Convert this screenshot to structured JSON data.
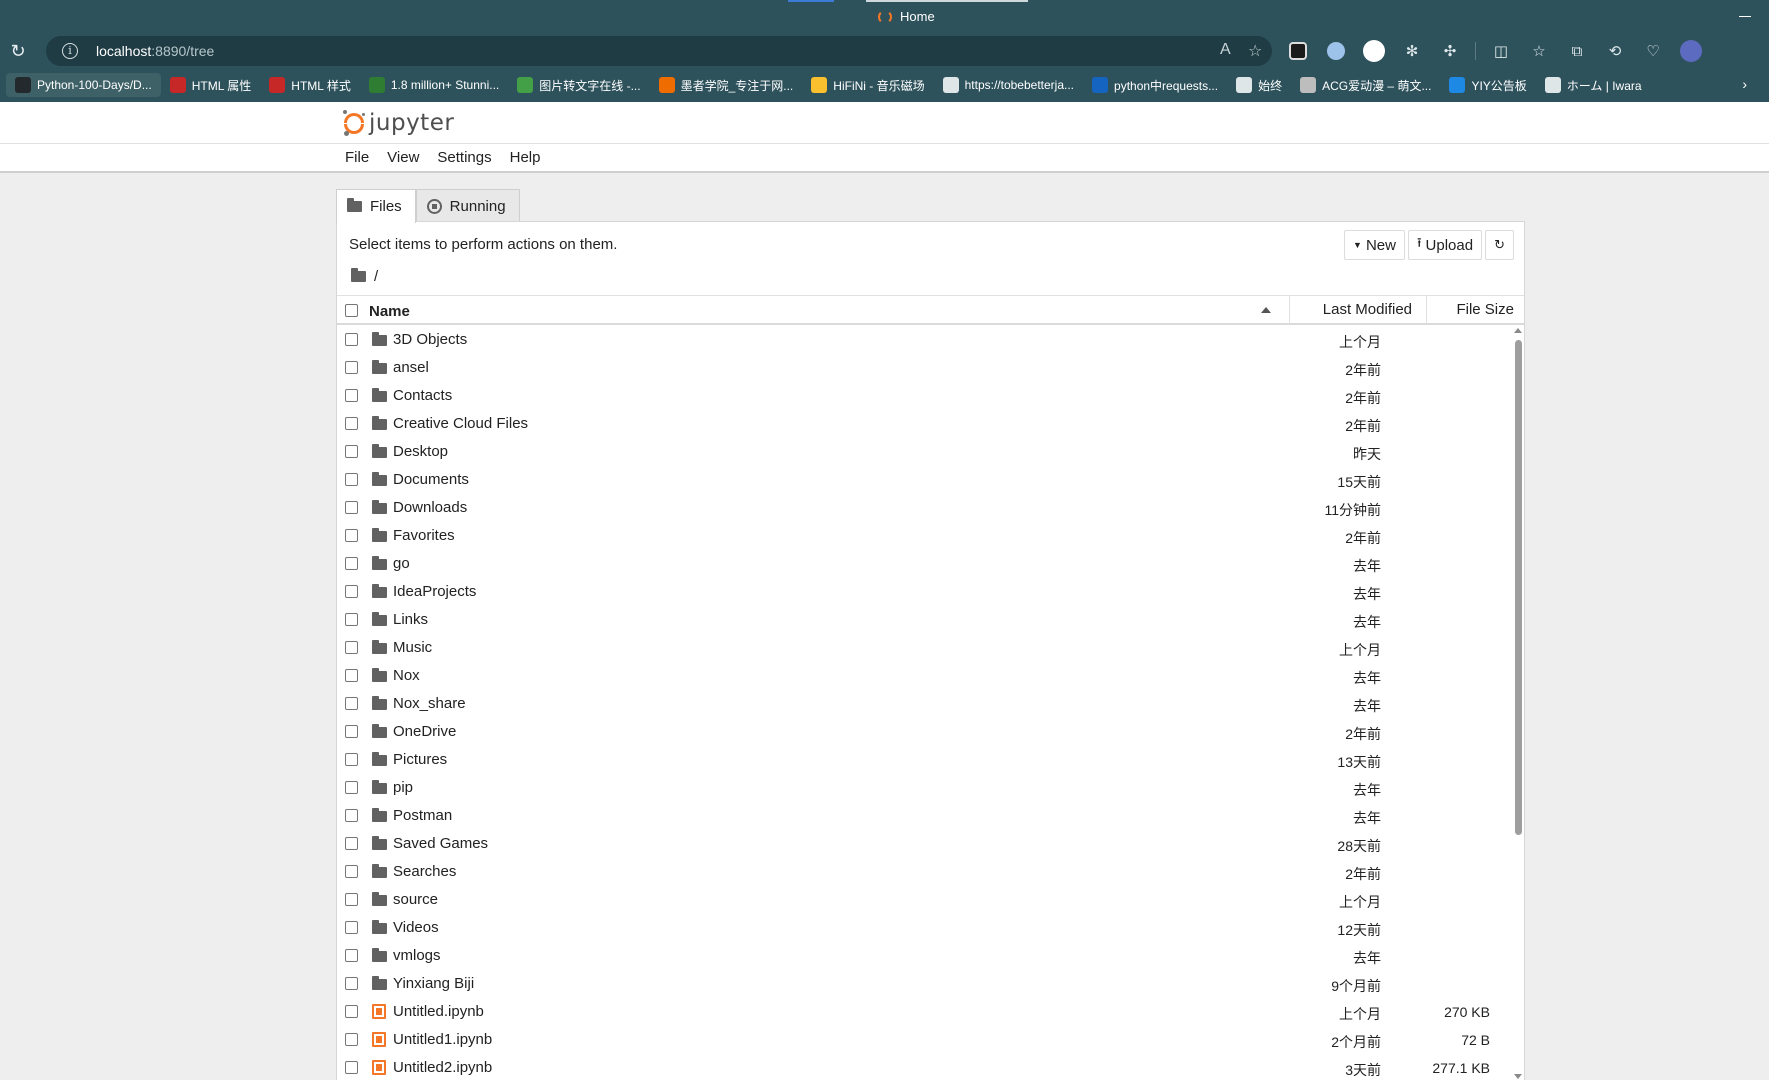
{
  "browser": {
    "tab_title": "Home",
    "url_host": "localhost",
    "url_rest": ":8890/tree",
    "bookmarks": [
      {
        "label": "Python-100-Days/D...",
        "icon": "github-icon",
        "color": "#24292e"
      },
      {
        "label": "HTML 属性",
        "icon": "html-icon",
        "color": "#c62828"
      },
      {
        "label": "HTML 样式",
        "icon": "html-icon",
        "color": "#c62828"
      },
      {
        "label": "1.8 million+ Stunni...",
        "icon": "px-icon",
        "color": "#2e7d32"
      },
      {
        "label": "图片转文字在线 -...",
        "icon": "leaf-icon",
        "color": "#43a047"
      },
      {
        "label": "墨者学院_专注于网...",
        "icon": "mozhe-icon",
        "color": "#ef6c00"
      },
      {
        "label": "HiFiNi - 音乐磁场",
        "icon": "music-icon",
        "color": "#fbc02d"
      },
      {
        "label": "https://tobebetterja...",
        "icon": "doc-icon",
        "color": "#eeeeee"
      },
      {
        "label": "python中requests...",
        "icon": "zhihu-icon",
        "color": "#1565c0"
      },
      {
        "label": "始终",
        "icon": "clock-icon",
        "color": "#ffffff"
      },
      {
        "label": "ACG爱动漫 – 萌文...",
        "icon": "acg-icon",
        "color": "#bdbdbd"
      },
      {
        "label": "YIY公告板",
        "icon": "s-icon",
        "color": "#1e88e5"
      },
      {
        "label": "ホーム | Iwara",
        "icon": "diamond-icon",
        "color": "#ffffff"
      }
    ]
  },
  "jupyter": {
    "logo_text": "jupyter",
    "menu": [
      "File",
      "View",
      "Settings",
      "Help"
    ],
    "tabs": {
      "files": "Files",
      "running": "Running"
    },
    "hint": "Select items to perform actions on them.",
    "buttons": {
      "new": "New",
      "upload": "Upload"
    },
    "breadcrumb": "/",
    "columns": {
      "name": "Name",
      "modified": "Last Modified",
      "size": "File Size"
    },
    "rows": [
      {
        "name": "3D Objects",
        "modified": "上个月",
        "size": "",
        "type": "folder"
      },
      {
        "name": "ansel",
        "modified": "2年前",
        "size": "",
        "type": "folder"
      },
      {
        "name": "Contacts",
        "modified": "2年前",
        "size": "",
        "type": "folder"
      },
      {
        "name": "Creative Cloud Files",
        "modified": "2年前",
        "size": "",
        "type": "folder"
      },
      {
        "name": "Desktop",
        "modified": "昨天",
        "size": "",
        "type": "folder"
      },
      {
        "name": "Documents",
        "modified": "15天前",
        "size": "",
        "type": "folder"
      },
      {
        "name": "Downloads",
        "modified": "11分钟前",
        "size": "",
        "type": "folder"
      },
      {
        "name": "Favorites",
        "modified": "2年前",
        "size": "",
        "type": "folder"
      },
      {
        "name": "go",
        "modified": "去年",
        "size": "",
        "type": "folder"
      },
      {
        "name": "IdeaProjects",
        "modified": "去年",
        "size": "",
        "type": "folder"
      },
      {
        "name": "Links",
        "modified": "去年",
        "size": "",
        "type": "folder"
      },
      {
        "name": "Music",
        "modified": "上个月",
        "size": "",
        "type": "folder"
      },
      {
        "name": "Nox",
        "modified": "去年",
        "size": "",
        "type": "folder"
      },
      {
        "name": "Nox_share",
        "modified": "去年",
        "size": "",
        "type": "folder"
      },
      {
        "name": "OneDrive",
        "modified": "2年前",
        "size": "",
        "type": "folder"
      },
      {
        "name": "Pictures",
        "modified": "13天前",
        "size": "",
        "type": "folder"
      },
      {
        "name": "pip",
        "modified": "去年",
        "size": "",
        "type": "folder"
      },
      {
        "name": "Postman",
        "modified": "去年",
        "size": "",
        "type": "folder"
      },
      {
        "name": "Saved Games",
        "modified": "28天前",
        "size": "",
        "type": "folder"
      },
      {
        "name": "Searches",
        "modified": "2年前",
        "size": "",
        "type": "folder"
      },
      {
        "name": "source",
        "modified": "上个月",
        "size": "",
        "type": "folder"
      },
      {
        "name": "Videos",
        "modified": "12天前",
        "size": "",
        "type": "folder"
      },
      {
        "name": "vmlogs",
        "modified": "去年",
        "size": "",
        "type": "folder"
      },
      {
        "name": "Yinxiang Biji",
        "modified": "9个月前",
        "size": "",
        "type": "folder"
      },
      {
        "name": "Untitled.ipynb",
        "modified": "上个月",
        "size": "270 KB",
        "type": "notebook"
      },
      {
        "name": "Untitled1.ipynb",
        "modified": "2个月前",
        "size": "72 B",
        "type": "notebook"
      },
      {
        "name": "Untitled2.ipynb",
        "modified": "3天前",
        "size": "277.1 KB",
        "type": "notebook"
      }
    ]
  },
  "colors": {
    "chrome": "#2e525c",
    "jupyter_orange": "#f37726",
    "page_bg": "#eeeeee"
  }
}
